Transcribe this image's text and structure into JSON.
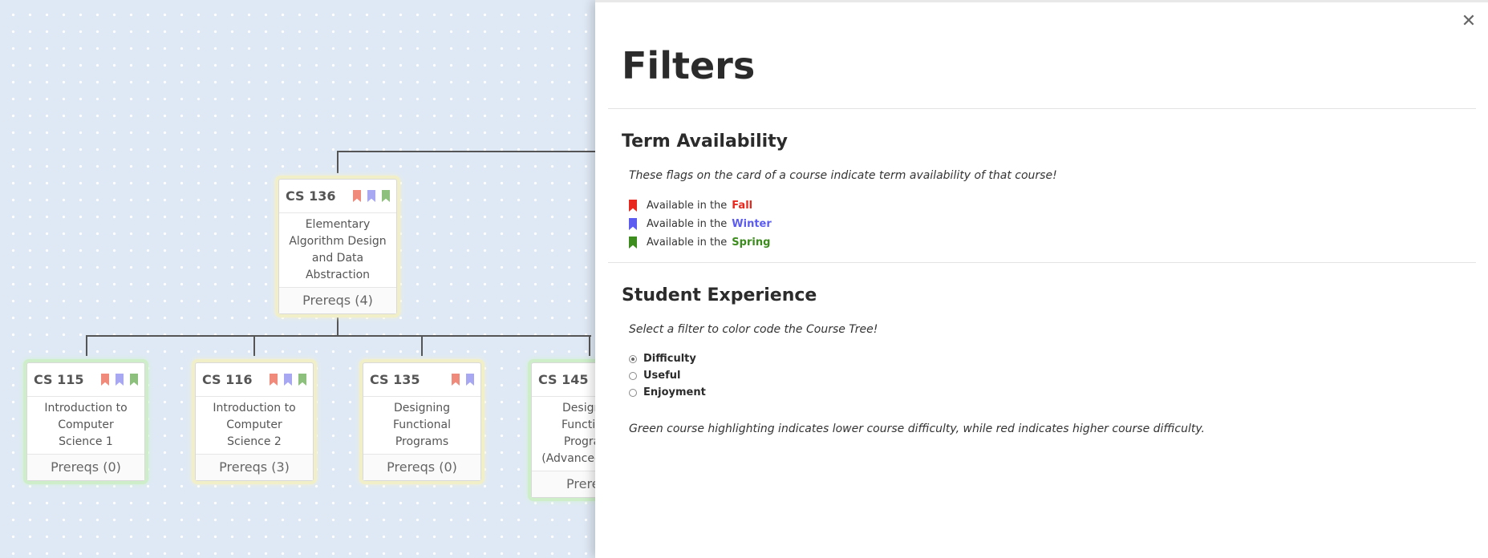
{
  "colors": {
    "fall": "#e8281e",
    "winter": "#5c5cf0",
    "spring": "#3c8c1e",
    "flag_fall_card": "#f08a7a",
    "flag_winter_card": "#a8a8f2",
    "flag_spring_card": "#8cc07c"
  },
  "cards": [
    {
      "code": "CS 136",
      "title": "Elementary Algorithm Design and Data Abstraction",
      "prereqs": "Prereqs (4)"
    },
    {
      "code": "CS 115",
      "title": "Introduction to Computer Science 1",
      "prereqs": "Prereqs (0)"
    },
    {
      "code": "CS 116",
      "title": "Introduction to Computer Science 2",
      "prereqs": "Prereqs (3)"
    },
    {
      "code": "CS 135",
      "title": "Designing Functional Programs",
      "prereqs": "Prereqs (0)"
    },
    {
      "code": "CS 145",
      "title": "Designing Functional Programs (Advanced Level)",
      "prereqs": "Prereqs"
    }
  ],
  "panel": {
    "title": "Filters",
    "term_section": {
      "heading": "Term Availability",
      "note": "These flags on the card of a course indicate term availability of that course!",
      "rows": [
        {
          "prefix": "Available in the",
          "term": "Fall"
        },
        {
          "prefix": "Available in the",
          "term": "Winter"
        },
        {
          "prefix": "Available in the",
          "term": "Spring"
        }
      ]
    },
    "experience_section": {
      "heading": "Student Experience",
      "note": "Select a filter to color code the Course Tree!",
      "options": [
        "Difficulty",
        "Useful",
        "Enjoyment"
      ],
      "selected": "Difficulty",
      "legend": "Green course highlighting indicates lower course difficulty, while red indicates higher course difficulty."
    }
  }
}
